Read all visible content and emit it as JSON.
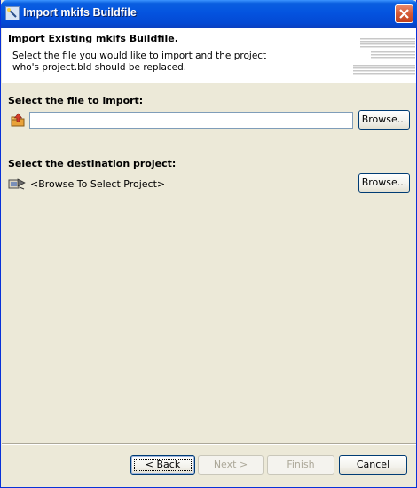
{
  "window": {
    "title": "Import mkifs Buildfile"
  },
  "header": {
    "title": "Import Existing mkifs Buildfile.",
    "description": "Select the file you would like to import and the project who's project.bld should be replaced."
  },
  "file_section": {
    "label": "Select the file to import:",
    "input_value": "",
    "browse_label": "Browse..."
  },
  "project_section": {
    "label": "Select the destination project:",
    "project_text": "<Browse To Select Project>",
    "browse_label": "Browse..."
  },
  "buttons": {
    "back": {
      "label": "< Back",
      "enabled": true
    },
    "next": {
      "label": "Next >",
      "enabled": false
    },
    "finish": {
      "label": "Finish",
      "enabled": false
    },
    "cancel": {
      "label": "Cancel",
      "enabled": true
    }
  },
  "icons": {
    "title": "wizard-icon",
    "close": "close-icon",
    "file": "folder-import-icon",
    "project": "project-icon"
  },
  "colors": {
    "titlebar": "#0454e0",
    "dialog_bg": "#ece9d8",
    "header_bg": "#ffffff",
    "close_button": "#d45a36",
    "disabled_text": "#aca899"
  }
}
